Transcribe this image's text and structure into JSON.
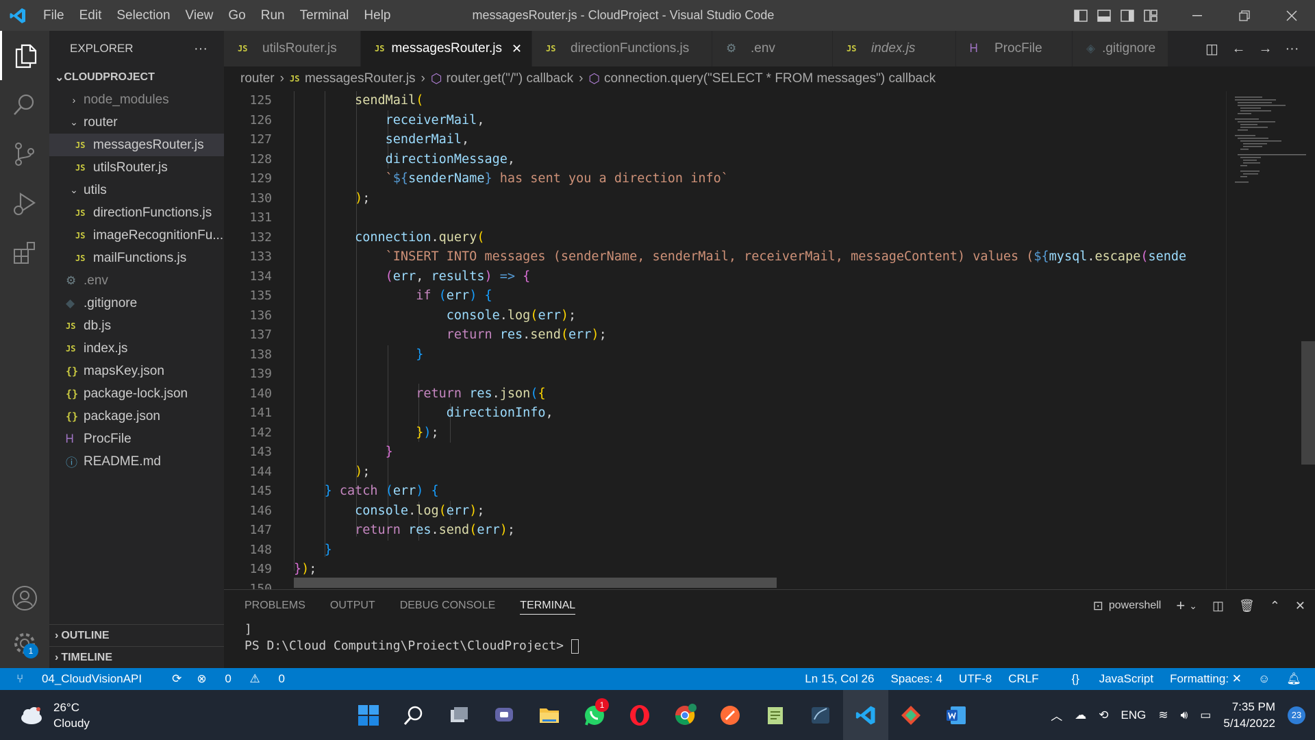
{
  "titlebar": {
    "menu": [
      "File",
      "Edit",
      "Selection",
      "View",
      "Go",
      "Run",
      "Terminal",
      "Help"
    ],
    "title": "messagesRouter.js - CloudProject - Visual Studio Code"
  },
  "activity": {
    "settings_badge": "1"
  },
  "sidebar": {
    "header": "EXPLORER",
    "more": "···",
    "project": "CLOUDPROJECT",
    "tree": [
      {
        "label": "node_modules",
        "icon": "chevron-right-icon"
      },
      {
        "label": "router",
        "icon": "chevron-down-icon"
      },
      {
        "label": "messagesRouter.js",
        "icon": "js-file-icon"
      },
      {
        "label": "utilsRouter.js",
        "icon": "js-file-icon"
      },
      {
        "label": "utils",
        "icon": "chevron-down-icon"
      },
      {
        "label": "directionFunctions.js",
        "icon": "js-file-icon"
      },
      {
        "label": "imageRecognitionFu...",
        "icon": "js-file-icon"
      },
      {
        "label": "mailFunctions.js",
        "icon": "js-file-icon"
      },
      {
        "label": ".env",
        "icon": "gear-icon"
      },
      {
        "label": ".gitignore",
        "icon": "git-icon"
      },
      {
        "label": "db.js",
        "icon": "js-file-icon"
      },
      {
        "label": "index.js",
        "icon": "js-file-icon"
      },
      {
        "label": "mapsKey.json",
        "icon": "json-icon"
      },
      {
        "label": "package-lock.json",
        "icon": "json-icon"
      },
      {
        "label": "package.json",
        "icon": "json-icon"
      },
      {
        "label": "ProcFile",
        "icon": "heroku-icon"
      },
      {
        "label": "README.md",
        "icon": "info-icon"
      }
    ],
    "outline": "OUTLINE",
    "timeline": "TIMELINE"
  },
  "tabs": [
    {
      "label": "utilsRouter.js",
      "icon": "JS"
    },
    {
      "label": "messagesRouter.js",
      "icon": "JS",
      "close": "✕"
    },
    {
      "label": "directionFunctions.js",
      "icon": "JS"
    },
    {
      "label": ".env",
      "icon": "⚙"
    },
    {
      "label": "index.js",
      "icon": "JS"
    },
    {
      "label": "ProcFile",
      "icon": "Ꮋ"
    },
    {
      "label": ".gitignore",
      "icon": "◈"
    }
  ],
  "breadcrumb": {
    "folder": "router",
    "file": "messagesRouter.js",
    "symbol1": "router.get(\"/\") callback",
    "symbol2": "connection.query(\"SELECT * FROM messages\") callback"
  },
  "editor": {
    "line_numbers": [
      "125",
      "126",
      "127",
      "128",
      "129",
      "130",
      "131",
      "132",
      "133",
      "134",
      "135",
      "136",
      "137",
      "138",
      "139",
      "140",
      "141",
      "142",
      "143",
      "144",
      "145",
      "146",
      "147",
      "148",
      "149",
      "150"
    ]
  },
  "panel": {
    "tabs": [
      "PROBLEMS",
      "OUTPUT",
      "DEBUG CONSOLE",
      "TERMINAL"
    ],
    "shell": "powershell",
    "terminal_line1": "]",
    "prompt": "PS D:\\Cloud Computing\\Proiect\\CloudProject> "
  },
  "statusbar": {
    "branch": "04_CloudVisionAPI",
    "errors": "0",
    "warnings": "0",
    "position": "Ln 15, Col 26",
    "spaces": "Spaces: 4",
    "encoding": "UTF-8",
    "eol": "CRLF",
    "language": "JavaScript",
    "formatting": "Formatting: ✕"
  },
  "taskbar": {
    "temp": "26°C",
    "weather": "Cloudy",
    "whatsapp_badge": "1",
    "lang": "ENG",
    "time": "7:35 PM",
    "date": "5/14/2022",
    "notifications": "23"
  },
  "colors": {
    "accent": "#007acc",
    "titlebar": "#3c3c3c",
    "sidebar": "#252526",
    "editor": "#1e1e1e"
  }
}
